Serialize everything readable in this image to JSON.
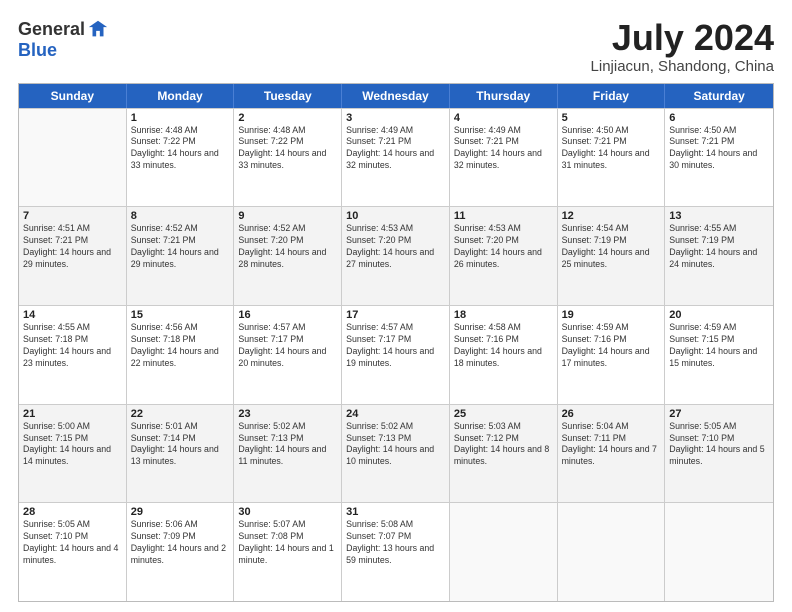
{
  "logo": {
    "general": "General",
    "blue": "Blue"
  },
  "title": "July 2024",
  "location": "Linjiacun, Shandong, China",
  "days": [
    "Sunday",
    "Monday",
    "Tuesday",
    "Wednesday",
    "Thursday",
    "Friday",
    "Saturday"
  ],
  "weeks": [
    [
      {
        "day": "",
        "sunrise": "",
        "sunset": "",
        "daylight": "",
        "empty": true
      },
      {
        "day": "1",
        "sunrise": "Sunrise: 4:48 AM",
        "sunset": "Sunset: 7:22 PM",
        "daylight": "Daylight: 14 hours and 33 minutes."
      },
      {
        "day": "2",
        "sunrise": "Sunrise: 4:48 AM",
        "sunset": "Sunset: 7:22 PM",
        "daylight": "Daylight: 14 hours and 33 minutes."
      },
      {
        "day": "3",
        "sunrise": "Sunrise: 4:49 AM",
        "sunset": "Sunset: 7:21 PM",
        "daylight": "Daylight: 14 hours and 32 minutes."
      },
      {
        "day": "4",
        "sunrise": "Sunrise: 4:49 AM",
        "sunset": "Sunset: 7:21 PM",
        "daylight": "Daylight: 14 hours and 32 minutes."
      },
      {
        "day": "5",
        "sunrise": "Sunrise: 4:50 AM",
        "sunset": "Sunset: 7:21 PM",
        "daylight": "Daylight: 14 hours and 31 minutes."
      },
      {
        "day": "6",
        "sunrise": "Sunrise: 4:50 AM",
        "sunset": "Sunset: 7:21 PM",
        "daylight": "Daylight: 14 hours and 30 minutes."
      }
    ],
    [
      {
        "day": "7",
        "sunrise": "Sunrise: 4:51 AM",
        "sunset": "Sunset: 7:21 PM",
        "daylight": "Daylight: 14 hours and 29 minutes."
      },
      {
        "day": "8",
        "sunrise": "Sunrise: 4:52 AM",
        "sunset": "Sunset: 7:21 PM",
        "daylight": "Daylight: 14 hours and 29 minutes."
      },
      {
        "day": "9",
        "sunrise": "Sunrise: 4:52 AM",
        "sunset": "Sunset: 7:20 PM",
        "daylight": "Daylight: 14 hours and 28 minutes."
      },
      {
        "day": "10",
        "sunrise": "Sunrise: 4:53 AM",
        "sunset": "Sunset: 7:20 PM",
        "daylight": "Daylight: 14 hours and 27 minutes."
      },
      {
        "day": "11",
        "sunrise": "Sunrise: 4:53 AM",
        "sunset": "Sunset: 7:20 PM",
        "daylight": "Daylight: 14 hours and 26 minutes."
      },
      {
        "day": "12",
        "sunrise": "Sunrise: 4:54 AM",
        "sunset": "Sunset: 7:19 PM",
        "daylight": "Daylight: 14 hours and 25 minutes."
      },
      {
        "day": "13",
        "sunrise": "Sunrise: 4:55 AM",
        "sunset": "Sunset: 7:19 PM",
        "daylight": "Daylight: 14 hours and 24 minutes."
      }
    ],
    [
      {
        "day": "14",
        "sunrise": "Sunrise: 4:55 AM",
        "sunset": "Sunset: 7:18 PM",
        "daylight": "Daylight: 14 hours and 23 minutes."
      },
      {
        "day": "15",
        "sunrise": "Sunrise: 4:56 AM",
        "sunset": "Sunset: 7:18 PM",
        "daylight": "Daylight: 14 hours and 22 minutes."
      },
      {
        "day": "16",
        "sunrise": "Sunrise: 4:57 AM",
        "sunset": "Sunset: 7:17 PM",
        "daylight": "Daylight: 14 hours and 20 minutes."
      },
      {
        "day": "17",
        "sunrise": "Sunrise: 4:57 AM",
        "sunset": "Sunset: 7:17 PM",
        "daylight": "Daylight: 14 hours and 19 minutes."
      },
      {
        "day": "18",
        "sunrise": "Sunrise: 4:58 AM",
        "sunset": "Sunset: 7:16 PM",
        "daylight": "Daylight: 14 hours and 18 minutes."
      },
      {
        "day": "19",
        "sunrise": "Sunrise: 4:59 AM",
        "sunset": "Sunset: 7:16 PM",
        "daylight": "Daylight: 14 hours and 17 minutes."
      },
      {
        "day": "20",
        "sunrise": "Sunrise: 4:59 AM",
        "sunset": "Sunset: 7:15 PM",
        "daylight": "Daylight: 14 hours and 15 minutes."
      }
    ],
    [
      {
        "day": "21",
        "sunrise": "Sunrise: 5:00 AM",
        "sunset": "Sunset: 7:15 PM",
        "daylight": "Daylight: 14 hours and 14 minutes."
      },
      {
        "day": "22",
        "sunrise": "Sunrise: 5:01 AM",
        "sunset": "Sunset: 7:14 PM",
        "daylight": "Daylight: 14 hours and 13 minutes."
      },
      {
        "day": "23",
        "sunrise": "Sunrise: 5:02 AM",
        "sunset": "Sunset: 7:13 PM",
        "daylight": "Daylight: 14 hours and 11 minutes."
      },
      {
        "day": "24",
        "sunrise": "Sunrise: 5:02 AM",
        "sunset": "Sunset: 7:13 PM",
        "daylight": "Daylight: 14 hours and 10 minutes."
      },
      {
        "day": "25",
        "sunrise": "Sunrise: 5:03 AM",
        "sunset": "Sunset: 7:12 PM",
        "daylight": "Daylight: 14 hours and 8 minutes."
      },
      {
        "day": "26",
        "sunrise": "Sunrise: 5:04 AM",
        "sunset": "Sunset: 7:11 PM",
        "daylight": "Daylight: 14 hours and 7 minutes."
      },
      {
        "day": "27",
        "sunrise": "Sunrise: 5:05 AM",
        "sunset": "Sunset: 7:10 PM",
        "daylight": "Daylight: 14 hours and 5 minutes."
      }
    ],
    [
      {
        "day": "28",
        "sunrise": "Sunrise: 5:05 AM",
        "sunset": "Sunset: 7:10 PM",
        "daylight": "Daylight: 14 hours and 4 minutes."
      },
      {
        "day": "29",
        "sunrise": "Sunrise: 5:06 AM",
        "sunset": "Sunset: 7:09 PM",
        "daylight": "Daylight: 14 hours and 2 minutes."
      },
      {
        "day": "30",
        "sunrise": "Sunrise: 5:07 AM",
        "sunset": "Sunset: 7:08 PM",
        "daylight": "Daylight: 14 hours and 1 minute."
      },
      {
        "day": "31",
        "sunrise": "Sunrise: 5:08 AM",
        "sunset": "Sunset: 7:07 PM",
        "daylight": "Daylight: 13 hours and 59 minutes."
      },
      {
        "day": "",
        "sunrise": "",
        "sunset": "",
        "daylight": "",
        "empty": true
      },
      {
        "day": "",
        "sunrise": "",
        "sunset": "",
        "daylight": "",
        "empty": true
      },
      {
        "day": "",
        "sunrise": "",
        "sunset": "",
        "daylight": "",
        "empty": true
      }
    ]
  ]
}
